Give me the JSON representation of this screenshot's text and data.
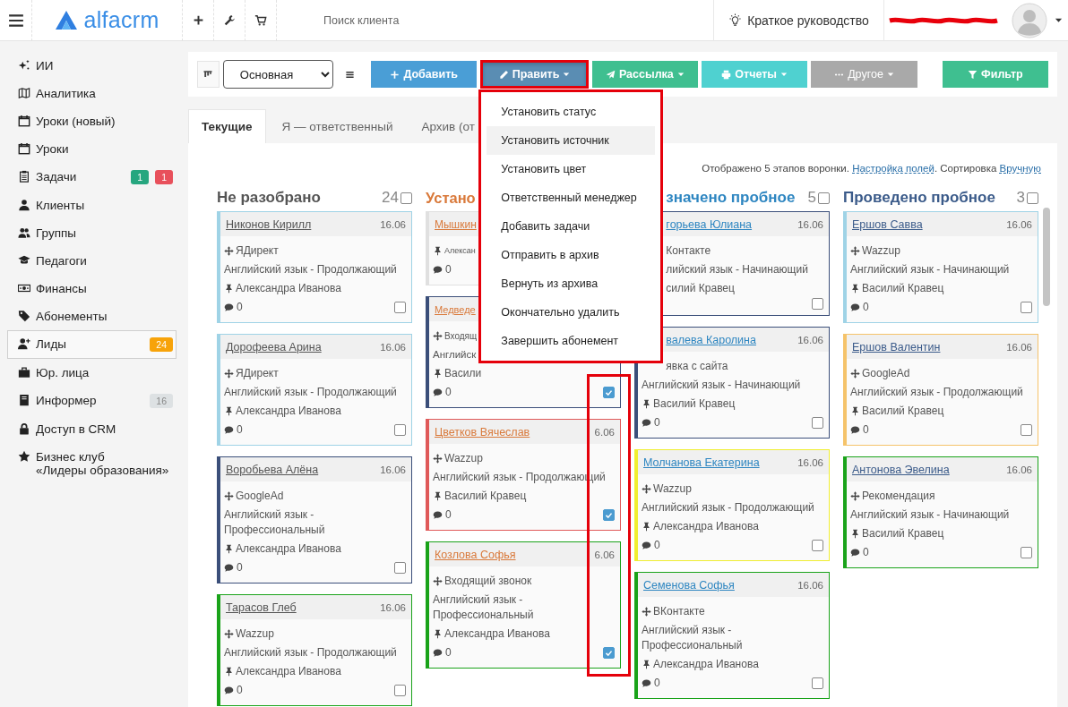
{
  "topbar": {
    "logo": "alfacrm",
    "search": {
      "placeholder": "Поиск клиента"
    },
    "guide": "Краткое руководство"
  },
  "sidebar": {
    "items": [
      {
        "label": "ИИ",
        "selected": false
      },
      {
        "label": "Аналитика",
        "selected": false
      },
      {
        "label": "Уроки (новый)",
        "selected": false
      },
      {
        "label": "Уроки",
        "selected": false
      },
      {
        "label": "Задачи",
        "selected": false,
        "badges": [
          {
            "text": "1",
            "color": "#26a67f"
          },
          {
            "text": "1",
            "color": "#e8505b"
          }
        ]
      },
      {
        "label": "Клиенты",
        "selected": false
      },
      {
        "label": "Группы",
        "selected": false
      },
      {
        "label": "Педагоги",
        "selected": false
      },
      {
        "label": "Финансы",
        "selected": false
      },
      {
        "label": "Абонементы",
        "selected": false
      },
      {
        "label": "Лиды",
        "selected": true,
        "badges": [
          {
            "text": "24",
            "color": "#f7a30a"
          }
        ]
      },
      {
        "label": "Юр. лица",
        "selected": false
      },
      {
        "label": "Информер",
        "selected": false,
        "badges": [
          {
            "text": "16",
            "color": "#dde1e3"
          }
        ]
      },
      {
        "label": "Доступ в CRM",
        "selected": false
      },
      {
        "label": "Бизнес клуб\n«Лидеры образования»",
        "selected": false
      }
    ]
  },
  "toolbar": {
    "view_select": "Основная",
    "buttons": [
      {
        "label": "Добавить",
        "color": "#4a9ed6",
        "dropdown": false,
        "disabled": false,
        "open": false,
        "outlined": false
      },
      {
        "label": "Править",
        "color": "#5a8db3",
        "dropdown": true,
        "disabled": false,
        "open": true,
        "outlined": true
      },
      {
        "label": "Рассылка",
        "color": "#3fbf90",
        "dropdown": true,
        "disabled": false,
        "open": false,
        "outlined": false
      },
      {
        "label": "Отчеты",
        "color": "#4fd1d0",
        "dropdown": true,
        "disabled": false,
        "open": false,
        "outlined": false
      },
      {
        "label": "Другое",
        "color": "#a9a9a9",
        "dropdown": true,
        "disabled": true,
        "open": false,
        "outlined": false
      },
      {
        "label": "Фильтр",
        "color": "#3fbf90",
        "dropdown": false,
        "disabled": false,
        "open": false,
        "outlined": false
      }
    ]
  },
  "edit_menu": {
    "outlined": true,
    "items": [
      {
        "label": "Установить статус",
        "hovered": false
      },
      {
        "label": "Установить источник",
        "hovered": true
      },
      {
        "label": "Установить цвет",
        "hovered": false
      },
      {
        "label": "Ответственный менеджер",
        "hovered": false
      },
      {
        "label": "Добавить задачи",
        "hovered": false
      },
      {
        "label": "Отправить в архив",
        "hovered": false
      },
      {
        "label": "Вернуть из архива",
        "hovered": false
      },
      {
        "label": "Окончательно удалить",
        "hovered": false
      },
      {
        "label": "Завершить абонемент",
        "hovered": false
      }
    ]
  },
  "tabs": [
    {
      "label": "Текущие",
      "selected": true
    },
    {
      "label": "Я — ответственный",
      "selected": false
    },
    {
      "label": "Архив (от",
      "selected": false
    }
  ],
  "board_info": {
    "text": "Отображено 5 этапов воронки.",
    "fields_link": "Настройка полей",
    "sort_text": ". Сортировка",
    "sort_link": "Вручную"
  },
  "columns": [
    {
      "title": "Не разобрано",
      "count": "24",
      "checked": false,
      "color": "#555555",
      "cards": [
        {
          "name": "Никонов Кирилл",
          "date": "16.06",
          "source": "ЯДирект",
          "course": "Английский язык - Продолжающий",
          "manager": "Александра Иванова",
          "comments": "0",
          "color": "#9fd3e6",
          "checked": false
        },
        {
          "name": "Дорофеева Арина",
          "date": "16.06",
          "source": "ЯДирект",
          "course": "Английский язык - Продолжающий",
          "manager": "Александра Иванова",
          "comments": "0",
          "color": "#9fd3e6",
          "checked": false
        },
        {
          "name": "Воробьева Алёна",
          "date": "16.06",
          "source": "GoogleAd",
          "course": "Английский язык - Профессиональный",
          "manager": "Александра Иванова",
          "comments": "0",
          "color": "#3b4f7a",
          "checked": false
        },
        {
          "name": "Тарасов Глеб",
          "date": "16.06",
          "source": "Wazzup",
          "course": "Английский язык - Продолжающий",
          "manager": "Александра Иванова",
          "comments": "0",
          "color": "#1aa31a",
          "checked": false
        }
      ]
    },
    {
      "title": "Устано",
      "color": "#d9793a",
      "checkbox_highlight": true,
      "cards": [
        {
          "name": "Мышкин",
          "manager": "Алексан",
          "comments": "0",
          "color": "#e0e0e0"
        },
        {
          "name": "Медведе",
          "source": "Входящ",
          "course": "Английск",
          "manager": "Васили",
          "comments": "0",
          "color": "#3b4f7a",
          "checked": true
        },
        {
          "name": "Цветков Вячеслав",
          "date": "6.06",
          "source": "Wazzup",
          "course": "Английский язык - Продолжающий",
          "manager": "Василий Кравец",
          "comments": "0",
          "color": "#e05a5a",
          "checked": true
        },
        {
          "name": "Козлова Софья",
          "date": "6.06",
          "source": "Входящий звонок",
          "course": "Английский язык - Профессиональный",
          "manager": "Александра Иванова",
          "comments": "0",
          "color": "#1aa31a",
          "checked": true
        }
      ]
    },
    {
      "title": "значено пробное",
      "count": "5",
      "checked": false,
      "color": "#2e86c1",
      "cards": [
        {
          "name": "горьева Юлиана",
          "date": "16.06",
          "source": "Контакте",
          "course": "лийский язык - Начинающий",
          "manager": "силий Кравец",
          "color": "#3b4f7a",
          "checked": false
        },
        {
          "name": "валева Каролина",
          "date": "16.06",
          "source": "явка с сайта",
          "course": "Английский язык - Начинающий",
          "manager": "Василий Кравец",
          "comments": "0",
          "color": "#3b4f7a",
          "checked": false
        },
        {
          "name": "Молчанова Екатерина",
          "date": "16.06",
          "source": "Wazzup",
          "course": "Английский язык - Продолжающий",
          "manager": "Александра Иванова",
          "comments": "0",
          "color": "#f0ee30",
          "checked": false
        },
        {
          "name": "Семенова Софья",
          "date": "16.06",
          "source": "ВКонтакте",
          "course": "Английский язык - Профессиональный",
          "manager": "Александра Иванова",
          "comments": "0",
          "color": "#1aa31a",
          "checked": false
        }
      ]
    },
    {
      "title": "Проведено пробное",
      "count": "3",
      "checked": false,
      "color": "#3b5b8a",
      "cards": [
        {
          "name": "Ершов Савва",
          "date": "16.06",
          "source": "Wazzup",
          "course": "Английский язык - Начинающий",
          "manager": "Василий Кравец",
          "comments": "0",
          "color": "#9fd3e6",
          "checked": false
        },
        {
          "name": "Ершов Валентин",
          "date": "16.06",
          "source": "GoogleAd",
          "course": "Английский язык - Продолжающий",
          "manager": "Василий Кравец",
          "comments": "0",
          "color": "#f5c36a",
          "checked": false
        },
        {
          "name": "Антонова Эвелина",
          "date": "16.06",
          "source": "Рекомендация",
          "course": "Английский язык - Начинающий",
          "manager": "Василий Кравец",
          "comments": "0",
          "color": "#1aa31a",
          "checked": false
        }
      ]
    }
  ]
}
